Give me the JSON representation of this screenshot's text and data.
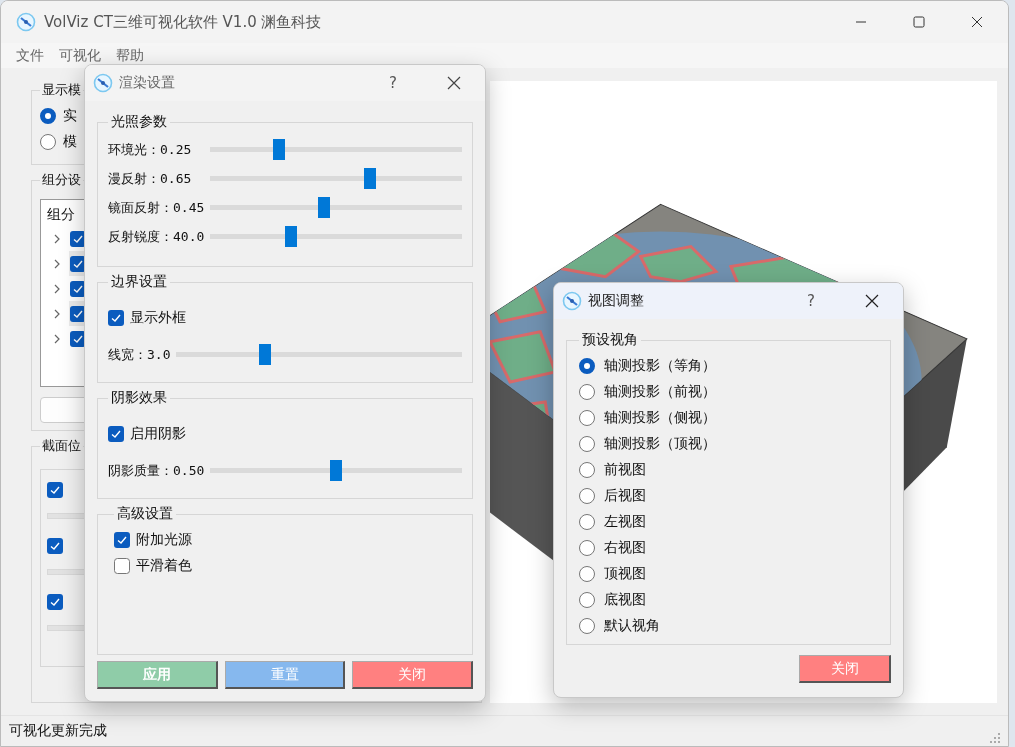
{
  "window": {
    "title": "VolViz CT三维可视化软件 V1.0 渊鱼科技"
  },
  "menu": [
    {
      "label": "文件"
    },
    {
      "label": "可视化"
    },
    {
      "label": "帮助"
    }
  ],
  "left_panel": {
    "display_mode": {
      "title": "显示模",
      "options": [
        {
          "label": "实",
          "selected": true
        },
        {
          "label": "模",
          "selected": false
        }
      ]
    },
    "components": {
      "title": "组分设",
      "header": "组分",
      "items": [
        {
          "checked": true
        },
        {
          "checked": true
        },
        {
          "checked": true
        },
        {
          "checked": true
        },
        {
          "checked": true
        }
      ]
    },
    "section": {
      "title": "截面位",
      "items": [
        {
          "checked": true
        },
        {
          "checked": true
        },
        {
          "checked": true
        }
      ]
    }
  },
  "render_dialog": {
    "title": "渲染设置",
    "help": "?",
    "lighting": {
      "title": "光照参数",
      "sliders": [
        {
          "label": "环境光：0.25",
          "level": 0.26
        },
        {
          "label": "漫反射：0.65",
          "level": 0.64
        },
        {
          "label": "镜面反射：0.45",
          "level": 0.45
        },
        {
          "label": "反射锐度：40.0",
          "level": 0.31
        }
      ]
    },
    "border": {
      "title": "边界设置",
      "checkbox": {
        "label": "显示外框",
        "checked": true
      },
      "slider": {
        "label": "线宽：3.0",
        "level": 0.3
      }
    },
    "shadow": {
      "title": "阴影效果",
      "checkbox": {
        "label": "启用阴影",
        "checked": true
      },
      "slider": {
        "label": "阴影质量：0.50",
        "level": 0.5
      }
    },
    "advanced": {
      "title": "高级设置",
      "checkboxes": [
        {
          "label": "附加光源",
          "checked": true
        },
        {
          "label": "平滑着色",
          "checked": false
        }
      ]
    },
    "buttons": [
      {
        "label": "应用",
        "color": "#8fcca8"
      },
      {
        "label": "重置",
        "color": "#86b8ee"
      },
      {
        "label": "关闭",
        "color": "#ff8080"
      }
    ]
  },
  "view_dialog": {
    "title": "视图调整",
    "help": "?",
    "group": "预设视角",
    "options": [
      {
        "label": "轴测投影（等角）",
        "selected": true
      },
      {
        "label": "轴测投影（前视）",
        "selected": false
      },
      {
        "label": "轴测投影（侧视）",
        "selected": false
      },
      {
        "label": "轴测投影（顶视）",
        "selected": false
      },
      {
        "label": "前视图",
        "selected": false
      },
      {
        "label": "后视图",
        "selected": false
      },
      {
        "label": "左视图",
        "selected": false
      },
      {
        "label": "右视图",
        "selected": false
      },
      {
        "label": "顶视图",
        "selected": false
      },
      {
        "label": "底视图",
        "selected": false
      },
      {
        "label": "默认视角",
        "selected": false
      }
    ],
    "button": {
      "label": "关闭",
      "color": "#ff8080"
    }
  },
  "status_bar": "可视化更新完成"
}
